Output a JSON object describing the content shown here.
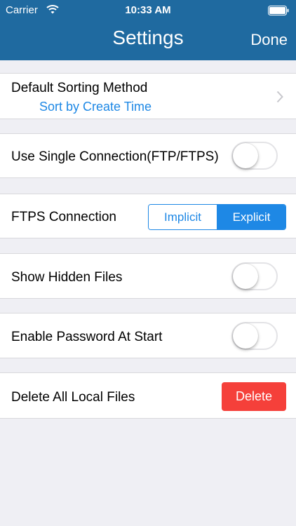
{
  "status_bar": {
    "carrier": "Carrier",
    "time": "10:33 AM"
  },
  "nav": {
    "title": "Settings",
    "done_label": "Done"
  },
  "settings": {
    "sorting": {
      "label": "Default Sorting Method",
      "value": "Sort by Create Time"
    },
    "single_connection": {
      "label": "Use Single Connection(FTP/FTPS)",
      "enabled": false
    },
    "ftps": {
      "label": "FTPS Connection",
      "options": [
        "Implicit",
        "Explicit"
      ],
      "selected": "Explicit"
    },
    "hidden_files": {
      "label": "Show Hidden Files",
      "enabled": false
    },
    "password": {
      "label": "Enable Password At Start",
      "enabled": false
    },
    "delete_files": {
      "label": "Delete All Local Files",
      "button_label": "Delete"
    }
  },
  "colors": {
    "nav_bar": "#1f6aa0",
    "accent": "#1e88e5",
    "destructive": "#f5403a",
    "background": "#efeff4"
  }
}
